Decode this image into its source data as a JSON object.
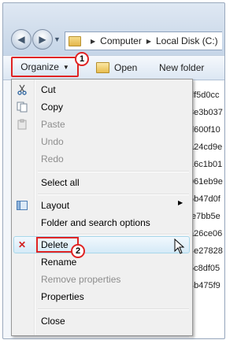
{
  "breadcrumb": [
    "Computer",
    "Local Disk (C:)"
  ],
  "toolbar": {
    "organize_label": "Organize",
    "open_label": "Open",
    "new_folder_label": "New folder"
  },
  "files": [
    "df5d0cc",
    "8e3b037",
    "d600f10",
    "a24cd9e",
    "16c1b01",
    "061eb9e",
    "5b47d0f",
    "fe7bb5e",
    "a26ce06",
    "4e27828",
    "5c8df05",
    "4b475f9"
  ],
  "menu": {
    "items": [
      {
        "label": "Cut",
        "icon": "scissors-icon",
        "disabled": false
      },
      {
        "label": "Copy",
        "icon": "copy-icon",
        "disabled": false
      },
      {
        "label": "Paste",
        "icon": "paste-icon",
        "disabled": true
      },
      {
        "label": "Undo",
        "disabled": true
      },
      {
        "label": "Redo",
        "disabled": true
      },
      {
        "label": "Select all",
        "disabled": false
      },
      {
        "label": "Layout",
        "icon": "layout-icon",
        "disabled": false
      },
      {
        "label": "Folder and search options",
        "disabled": false
      },
      {
        "label": "Delete",
        "icon": "delete-x-icon",
        "disabled": false
      },
      {
        "label": "Rename",
        "disabled": false
      },
      {
        "label": "Remove properties",
        "disabled": true
      },
      {
        "label": "Properties",
        "disabled": false
      },
      {
        "label": "Close",
        "disabled": false
      }
    ]
  },
  "annotations": {
    "step1": "1",
    "step2": "2"
  },
  "colors": {
    "annotation_red": "#e02424",
    "highlight": "#d5eaf7"
  }
}
